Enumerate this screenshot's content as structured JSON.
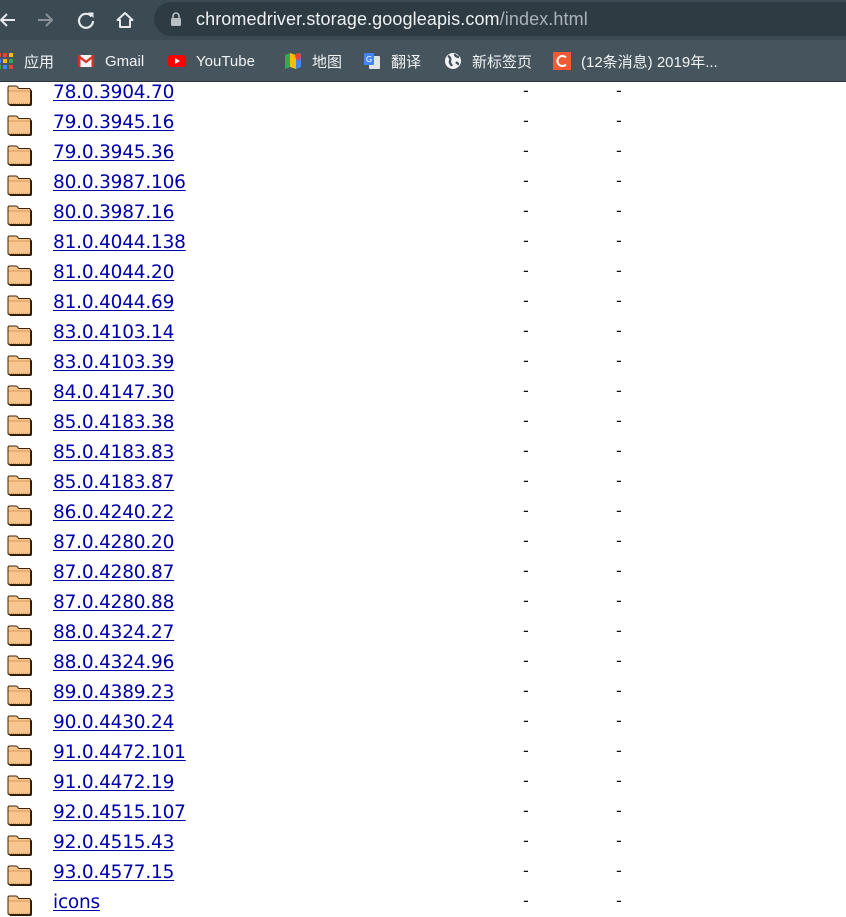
{
  "browser": {
    "url_host": "chromedriver.storage.googleapis.com",
    "url_path": "/index.html",
    "icons": {
      "back": "arrow-left-icon",
      "forward": "arrow-right-icon",
      "reload": "reload-icon",
      "home": "home-icon",
      "secure": "lock-icon"
    }
  },
  "bookmarks": [
    {
      "label": "应用",
      "icon": "apps-grid-icon"
    },
    {
      "label": "Gmail",
      "icon": "gmail-icon"
    },
    {
      "label": "YouTube",
      "icon": "youtube-icon"
    },
    {
      "label": "地图",
      "icon": "maps-icon"
    },
    {
      "label": "翻译",
      "icon": "translate-icon"
    },
    {
      "label": "新标签页",
      "icon": "globe-icon"
    },
    {
      "label": "(12条消息) 2019年...",
      "icon": "csdn-icon"
    }
  ],
  "listing": {
    "rows": [
      {
        "name": "78.0.3904.70",
        "modified": "-",
        "size": "-"
      },
      {
        "name": "79.0.3945.16",
        "modified": "-",
        "size": "-"
      },
      {
        "name": "79.0.3945.36",
        "modified": "-",
        "size": "-"
      },
      {
        "name": "80.0.3987.106",
        "modified": "-",
        "size": "-"
      },
      {
        "name": "80.0.3987.16",
        "modified": "-",
        "size": "-"
      },
      {
        "name": "81.0.4044.138",
        "modified": "-",
        "size": "-"
      },
      {
        "name": "81.0.4044.20",
        "modified": "-",
        "size": "-"
      },
      {
        "name": "81.0.4044.69",
        "modified": "-",
        "size": "-"
      },
      {
        "name": "83.0.4103.14",
        "modified": "-",
        "size": "-"
      },
      {
        "name": "83.0.4103.39",
        "modified": "-",
        "size": "-"
      },
      {
        "name": "84.0.4147.30",
        "modified": "-",
        "size": "-"
      },
      {
        "name": "85.0.4183.38",
        "modified": "-",
        "size": "-"
      },
      {
        "name": "85.0.4183.83",
        "modified": "-",
        "size": "-"
      },
      {
        "name": "85.0.4183.87",
        "modified": "-",
        "size": "-"
      },
      {
        "name": "86.0.4240.22",
        "modified": "-",
        "size": "-"
      },
      {
        "name": "87.0.4280.20",
        "modified": "-",
        "size": "-"
      },
      {
        "name": "87.0.4280.87",
        "modified": "-",
        "size": "-"
      },
      {
        "name": "87.0.4280.88",
        "modified": "-",
        "size": "-"
      },
      {
        "name": "88.0.4324.27",
        "modified": "-",
        "size": "-"
      },
      {
        "name": "88.0.4324.96",
        "modified": "-",
        "size": "-"
      },
      {
        "name": "89.0.4389.23",
        "modified": "-",
        "size": "-"
      },
      {
        "name": "90.0.4430.24",
        "modified": "-",
        "size": "-"
      },
      {
        "name": "91.0.4472.101",
        "modified": "-",
        "size": "-"
      },
      {
        "name": "91.0.4472.19",
        "modified": "-",
        "size": "-"
      },
      {
        "name": "92.0.4515.107",
        "modified": "-",
        "size": "-"
      },
      {
        "name": "92.0.4515.43",
        "modified": "-",
        "size": "-"
      },
      {
        "name": "93.0.4577.15",
        "modified": "-",
        "size": "-"
      },
      {
        "name": "icons",
        "modified": "-",
        "size": "-"
      }
    ]
  },
  "colors": {
    "toolbar_bg": "#3c4a53",
    "bookmarks_bg": "#45545d",
    "link": "#0000aa",
    "folder_fill": "#f7c58d"
  }
}
